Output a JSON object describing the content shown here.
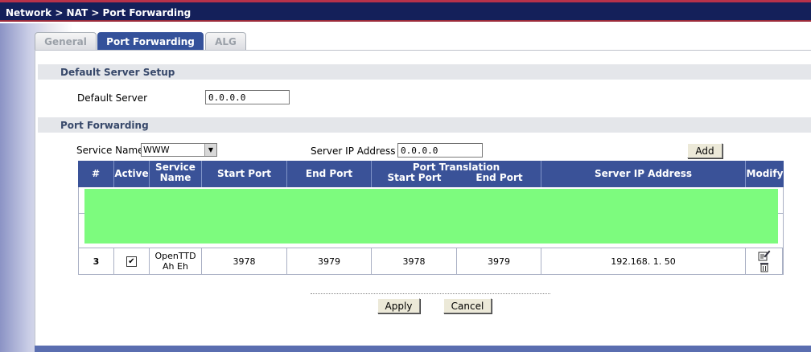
{
  "breadcrumb": "Network > NAT > Port Forwarding",
  "tabs": [
    {
      "label": "General"
    },
    {
      "label": "Port Forwarding"
    },
    {
      "label": "ALG"
    }
  ],
  "default_server_section": {
    "title": "Default Server Setup",
    "field_label": "Default Server",
    "field_value": "0.0.0.0"
  },
  "port_forwarding_section": {
    "title": "Port Forwarding",
    "service_name_label": "Service Name",
    "service_name_value": "WWW",
    "server_ip_label": "Server IP Address",
    "server_ip_value": "0.0.0.0",
    "add_label": "Add"
  },
  "table": {
    "headers": {
      "num": "#",
      "active": "Active",
      "service_name_1": "Service",
      "service_name_2": "Name",
      "start_port": "Start Port",
      "end_port": "End Port",
      "port_translation": "Port Translation",
      "pt_start": "Start Port",
      "pt_end": "End Port",
      "server_ip": "Server IP Address",
      "modify": "Modify"
    },
    "row": {
      "num": "3",
      "active_mark": "✔",
      "service_name_1": "OpenTTD",
      "service_name_2": "Ah Eh",
      "start_port": "3978",
      "end_port": "3979",
      "pt_start": "3978",
      "pt_end": "3979",
      "server_ip": "192.168. 1. 50"
    }
  },
  "buttons": {
    "apply": "Apply",
    "cancel": "Cancel"
  },
  "colors": {
    "title_bar": "#14205a",
    "active_tab": "#34519a",
    "table_header": "#3a5298",
    "redacted_block": "#7dfb7e"
  },
  "icons": {
    "edit": "edit-icon",
    "delete": "trash-icon",
    "dropdown": "chevron-down-icon"
  }
}
